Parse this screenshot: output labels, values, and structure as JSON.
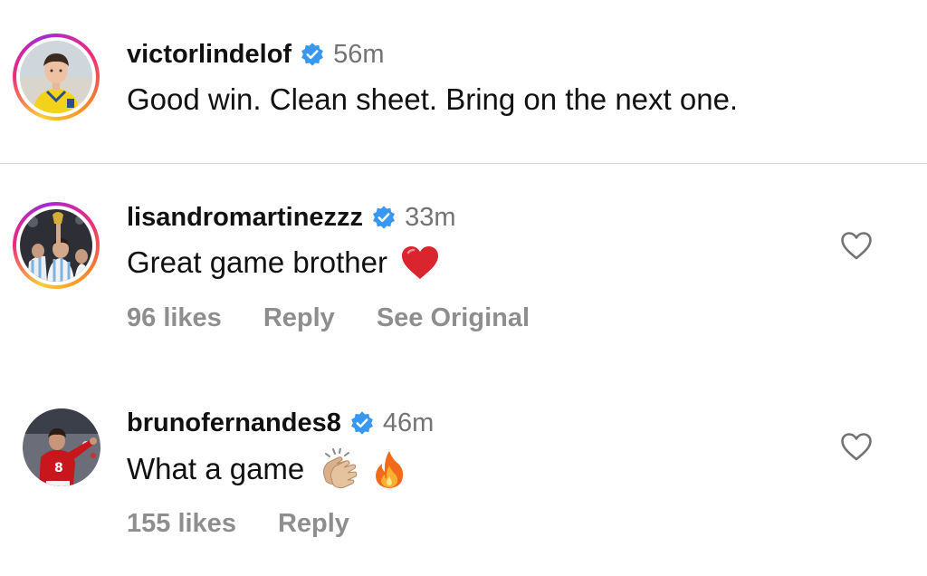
{
  "post": {
    "username": "victorlindelof",
    "verified": true,
    "time": "56m",
    "text": "Good win. Clean sheet. Bring on the next one."
  },
  "comments": [
    {
      "username": "lisandromartinezzz",
      "verified": true,
      "time": "33m",
      "text": "Great game brother",
      "emojis": [
        "red-heart"
      ],
      "likes": "96 likes",
      "reply": "Reply",
      "see_original": "See Original"
    },
    {
      "username": "brunofernandes8",
      "verified": true,
      "time": "46m",
      "text": "What a game",
      "emojis": [
        "clapping-hands",
        "fire"
      ],
      "likes": "155 likes",
      "reply": "Reply"
    }
  ],
  "colors": {
    "verified_blue": "#3897f0",
    "muted_text": "#737373",
    "action_text": "#8e8e8e",
    "heart_red": "#d9262e",
    "divider": "#dbdbdb"
  }
}
